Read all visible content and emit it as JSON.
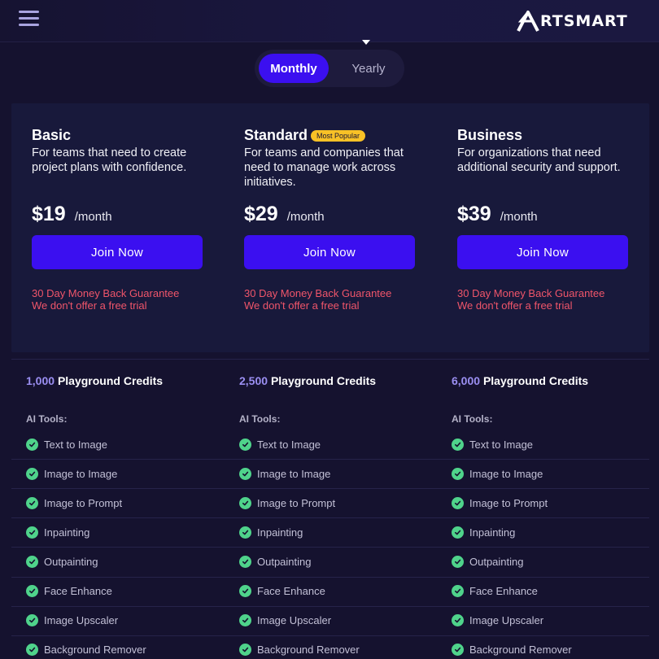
{
  "header": {
    "menu_icon": "hamburger-menu-icon",
    "logo_text": "RTSMART",
    "logo_icon": "artsmart-a-logo-icon"
  },
  "billing_toggle": {
    "monthly_label": "Monthly",
    "yearly_label": "Yearly",
    "selected": "Monthly"
  },
  "plans": [
    {
      "name": "Basic",
      "badge": "",
      "description": "For teams that need to create project plans with confidence.",
      "price": "$19",
      "period": "/month",
      "button_label": "Join Now",
      "guarantee_line1": "30 Day Money Back Guarantee",
      "guarantee_line2": "We don't offer a free trial",
      "credits_amount": "1,000",
      "credits_label": "Playground Credits"
    },
    {
      "name": "Standard",
      "badge": "Most Popular",
      "description": "For teams and companies that need to manage work across initiatives.",
      "price": "$29",
      "period": "/month",
      "button_label": "Join Now",
      "guarantee_line1": "30 Day Money Back Guarantee",
      "guarantee_line2": "We don't offer a free trial",
      "credits_amount": "2,500",
      "credits_label": "Playground Credits"
    },
    {
      "name": "Business",
      "badge": "",
      "description": "For organizations that need additional security and support.",
      "price": "$39",
      "period": "/month",
      "button_label": "Join Now",
      "guarantee_line1": "30 Day Money Back Guarantee",
      "guarantee_line2": "We don't offer a free trial",
      "credits_amount": "6,000",
      "credits_label": "Playground Credits"
    }
  ],
  "tools_label": "AI Tools:",
  "features": [
    "Text to Image",
    "Image to Image",
    "Image to Prompt",
    "Inpainting",
    "Outpainting",
    "Face Enhance",
    "Image Upscaler",
    "Background Remover"
  ],
  "colors": {
    "accent": "#3b0ff0",
    "background": "#15122f",
    "guarantee": "#f0556a",
    "badge": "#f8c126",
    "check": "#4fd38b",
    "credits_number": "#9b8ff2"
  }
}
